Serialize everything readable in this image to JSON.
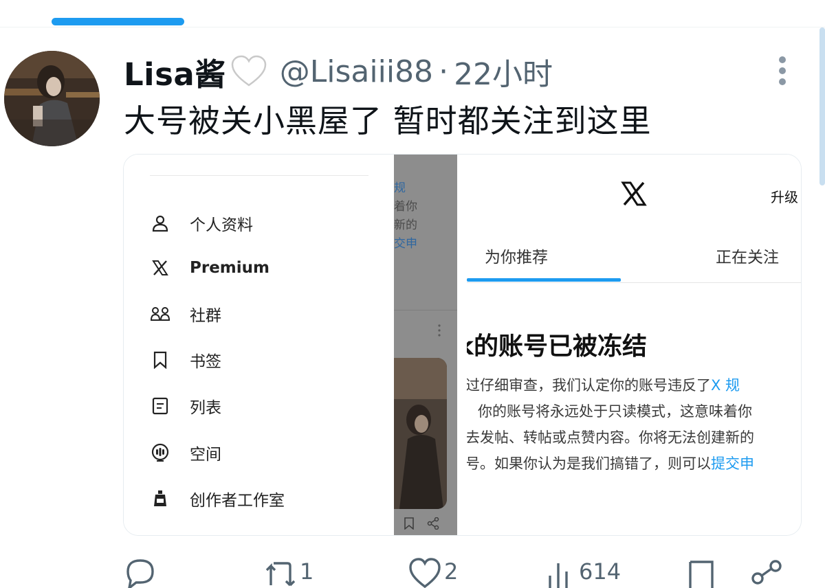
{
  "tweet": {
    "display_name": "Lisa酱",
    "heart_emoji": "white-heart",
    "handle": "@Lisaiii88",
    "separator": "·",
    "time": "22小时",
    "text": "大号被关小黑屋了 暂时都关注到这里"
  },
  "media": {
    "left_panel": {
      "menu": [
        {
          "icon": "person-icon",
          "label": "个人资料"
        },
        {
          "icon": "x-logo-icon",
          "label": "Premium"
        },
        {
          "icon": "communities-icon",
          "label": "社群"
        },
        {
          "icon": "bookmark-icon",
          "label": "书签"
        },
        {
          "icon": "list-icon",
          "label": "列表"
        },
        {
          "icon": "spaces-icon",
          "label": "空间"
        },
        {
          "icon": "creator-studio-icon",
          "label": "创作者工作室"
        }
      ]
    },
    "dim_panel": {
      "lines": [
        "规",
        "着你",
        "新的",
        "交申"
      ]
    },
    "right_panel": {
      "logo": "X",
      "upgrade": "升级",
      "tabs": [
        "为你推荐",
        "正在关注"
      ],
      "title": "k的账号已被冻结",
      "body": {
        "line1_text": "过仔细审查，我们认定你的账号违反了",
        "line1_link": "X 规",
        "line2": "你的账号将永远处于只读模式，这意味着你",
        "line3": "去发帖、转帖或点赞内容。你将无法创建新的",
        "line4_text": "号。如果你认为是我们搞错了，则可以",
        "line4_link": "提交申"
      }
    }
  },
  "actions": {
    "reply_count": "",
    "retweet_count": "1",
    "like_count": "2",
    "views_count": "614"
  },
  "colors": {
    "accent": "#1d9bf0",
    "secondary_text": "#536471",
    "primary_text": "#0f1419"
  }
}
